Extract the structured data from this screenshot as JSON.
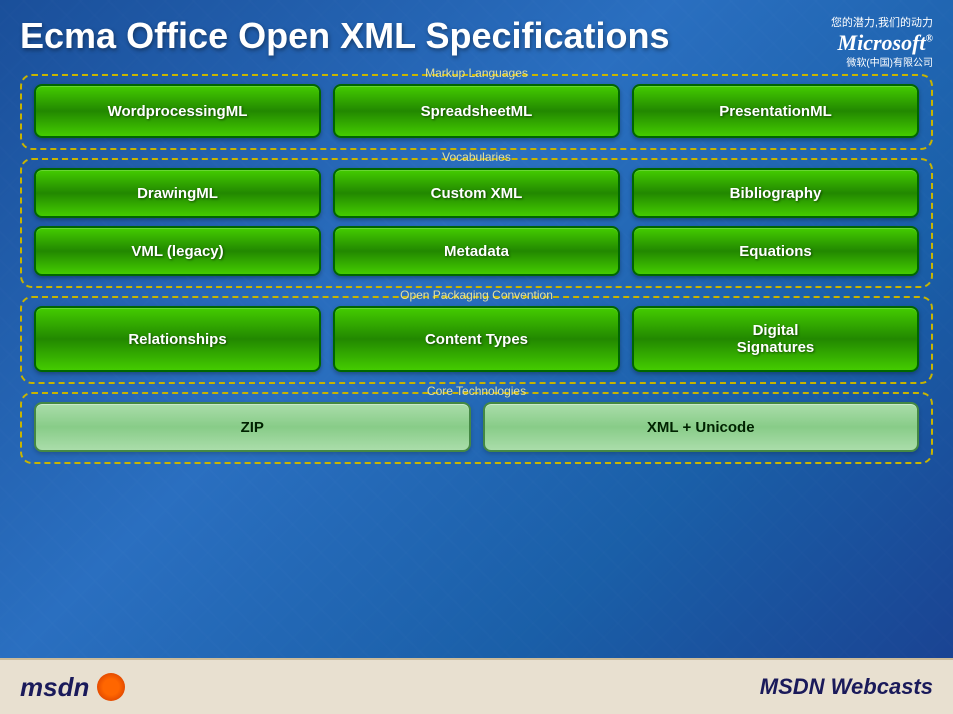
{
  "header": {
    "tagline": "您的潜力,我们的动力",
    "microsoft": "Microsoft",
    "microsoft_sup": "®",
    "ms_subtitle": "微软(中国)有限公司",
    "title": "Ecma Office Open XML Specifications"
  },
  "sections": {
    "markup": {
      "label": "Markup Languages",
      "items": [
        "WordprocessingML",
        "SpreadsheetML",
        "PresentationML"
      ]
    },
    "vocab": {
      "label": "Vocabularies",
      "row1": [
        "DrawingML",
        "Custom XML",
        "Bibliography"
      ],
      "row2": [
        "VML (legacy)",
        "Metadata",
        "Equations"
      ]
    },
    "packaging": {
      "label": "Open Packaging Convention",
      "items": [
        "Relationships",
        "Content Types",
        "Digital\nSignatures"
      ]
    },
    "core": {
      "label": "Core Technologies",
      "items": [
        "ZIP",
        "XML + Unicode"
      ]
    }
  },
  "footer": {
    "msdn_label": "msdn",
    "webcasts_label": "MSDN Webcasts"
  }
}
